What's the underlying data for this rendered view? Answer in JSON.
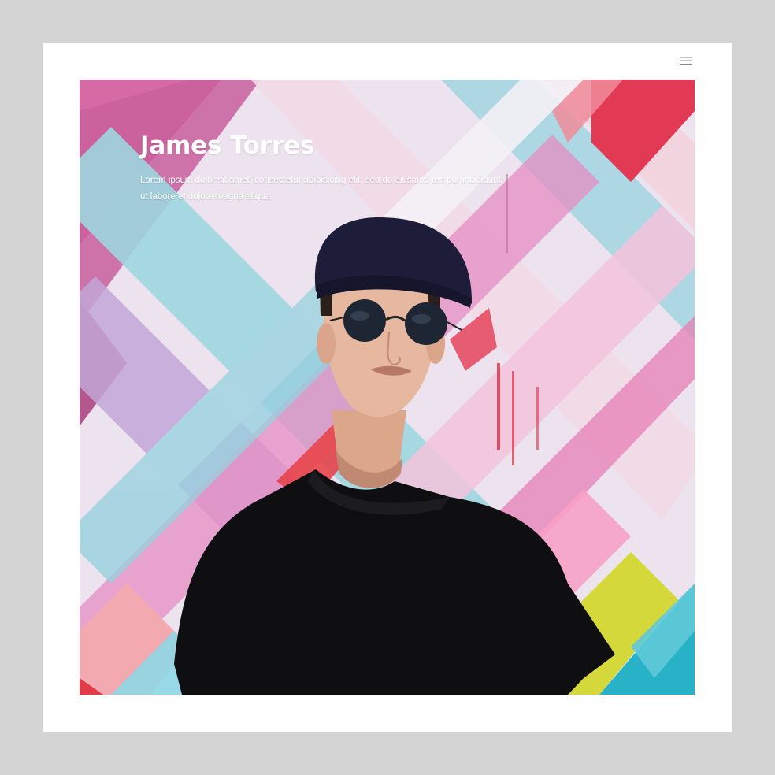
{
  "header": {
    "menu_icon": "hamburger-menu-icon"
  },
  "hero": {
    "name": "James Torres",
    "description": "Lorem ipsum dolor sit amet, consectetur adipisicing elit, sed do eiusmod tempor incididunt ut labore et dolore magna aliqua.",
    "image": "portrait-photo"
  },
  "colors": {
    "page_background": "#d4d4d4",
    "frame_background": "#ffffff",
    "menu_icon": "#8a8a8a",
    "hero_text": "#ffffff"
  }
}
